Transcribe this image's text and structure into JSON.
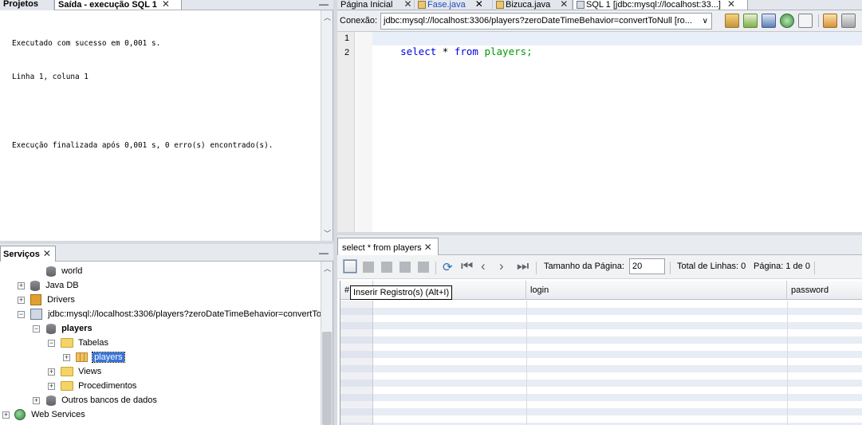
{
  "left_top": {
    "tab_projects": "Projetos",
    "tab_output": "Saída - execução SQL 1",
    "output_lines": [
      "Executado com sucesso em 0,001 s.",
      "Linha 1, coluna 1",
      "",
      "Execução finalizada após 0,001 s, 0 erro(s) encontrado(s)."
    ]
  },
  "services": {
    "tab_label": "Serviços",
    "items": {
      "world": "world",
      "javadb": "Java DB",
      "drivers": "Drivers",
      "connection": "jdbc:mysql://localhost:3306/players?zeroDateTimeBehavior=convertTo",
      "players_db": "players",
      "tabelas": "Tabelas",
      "players_table": "players",
      "views": "Views",
      "procedimentos": "Procedimentos",
      "outros": "Outros bancos de dados",
      "webservices": "Web Services"
    }
  },
  "editor": {
    "tabs": [
      "Página Inicial",
      "Fase.java",
      "Bizuca.java",
      "SQL 1 [jdbc:mysql://localhost:33...]"
    ],
    "conn_label": "Conexão:",
    "conn_value": "jdbc:mysql://localhost:3306/players?zeroDateTimeBehavior=convertToNull [ro...",
    "line_numbers": [
      "1",
      "2"
    ],
    "sql": {
      "kw1": "select",
      "star": " * ",
      "kw2": "from",
      "table": " players;"
    }
  },
  "results": {
    "tab_label": "select * from players",
    "page_size_label": "Tamanho da Página:",
    "page_size_value": "20",
    "total_rows": "Total de Linhas: 0",
    "page_of": "Página: 1 de 0",
    "tooltip": "Inserir Registro(s) (Alt+I)",
    "columns": [
      "#",
      "",
      "login",
      "password"
    ]
  },
  "colors": {
    "keyword": "#0000e6",
    "identifier": "#009900",
    "selection": "#3874d8",
    "row_alt": "#e8ecf5"
  }
}
